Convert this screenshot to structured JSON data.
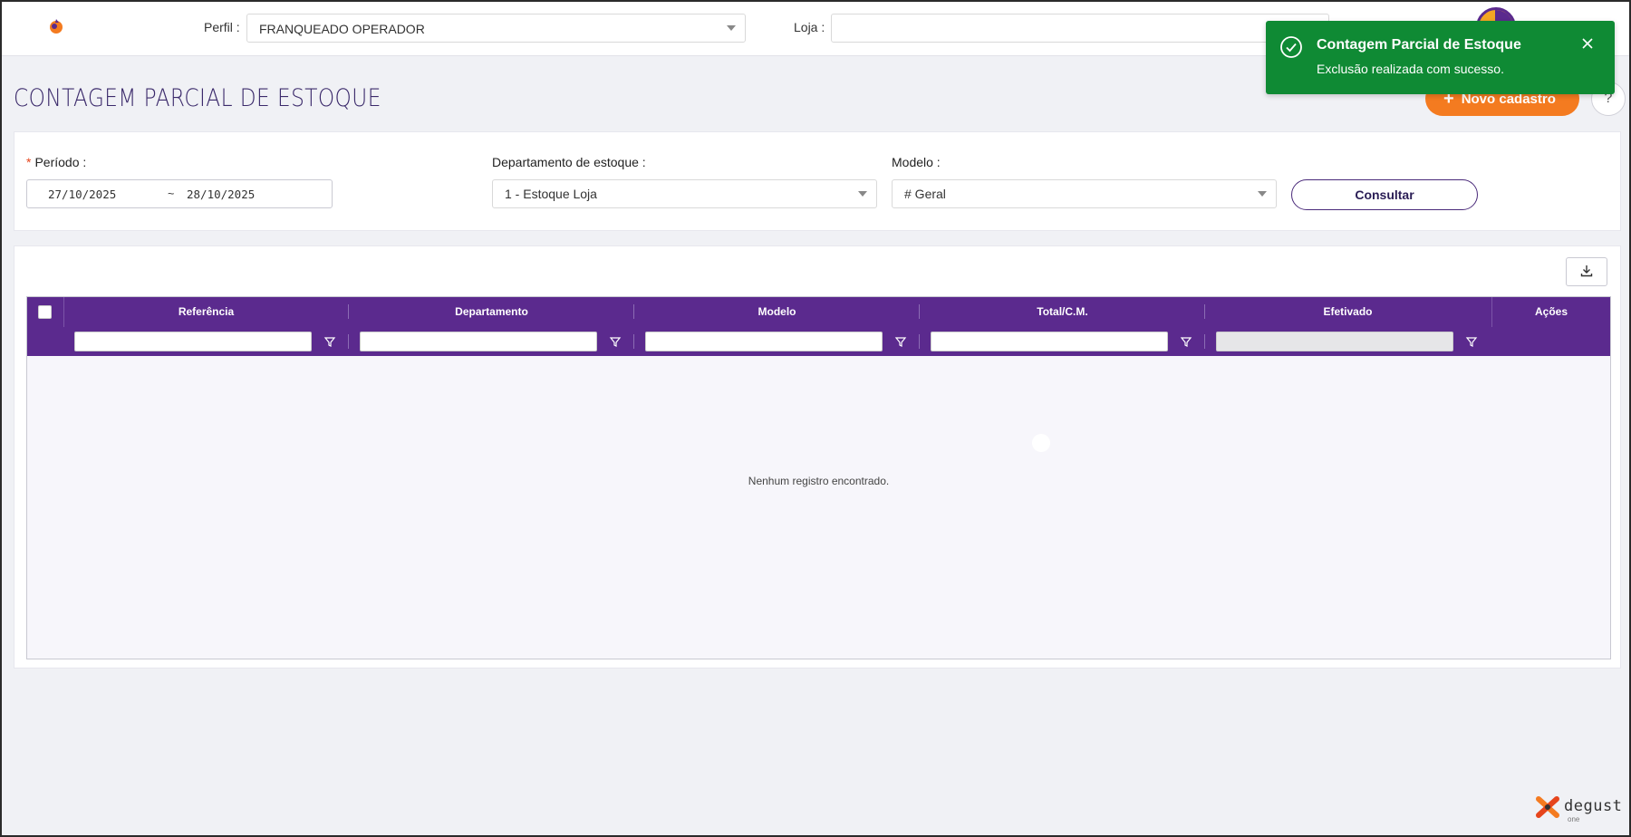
{
  "header": {
    "perfil_label": "Perfil :",
    "perfil_value": "FRANQUEADO OPERADOR",
    "loja_label": "Loja :",
    "loja_value": ""
  },
  "page": {
    "title": "CONTAGEM PARCIAL DE ESTOQUE",
    "new_button": "Novo cadastro",
    "help_button": "?"
  },
  "filters": {
    "periodo_label": "Período :",
    "date_from": "27/10/2025",
    "date_sep": "~",
    "date_to": "28/10/2025",
    "departamento_label": "Departamento de estoque :",
    "departamento_value": "1 - Estoque Loja",
    "modelo_label": "Modelo :",
    "modelo_value": "# Geral",
    "consult_button": "Consultar"
  },
  "grid": {
    "columns": [
      "Referência",
      "Departamento",
      "Modelo",
      "Total/C.M.",
      "Efetivado",
      "Ações"
    ],
    "empty_message": "Nenhum registro encontrado."
  },
  "toast": {
    "title": "Contagem Parcial de Estoque",
    "message": "Exclusão realizada com sucesso."
  },
  "brand": {
    "name": "degust",
    "sub": "one"
  },
  "colors": {
    "primary": "#5b2a8e",
    "accent": "#f47b20",
    "success": "#0f8a34"
  }
}
